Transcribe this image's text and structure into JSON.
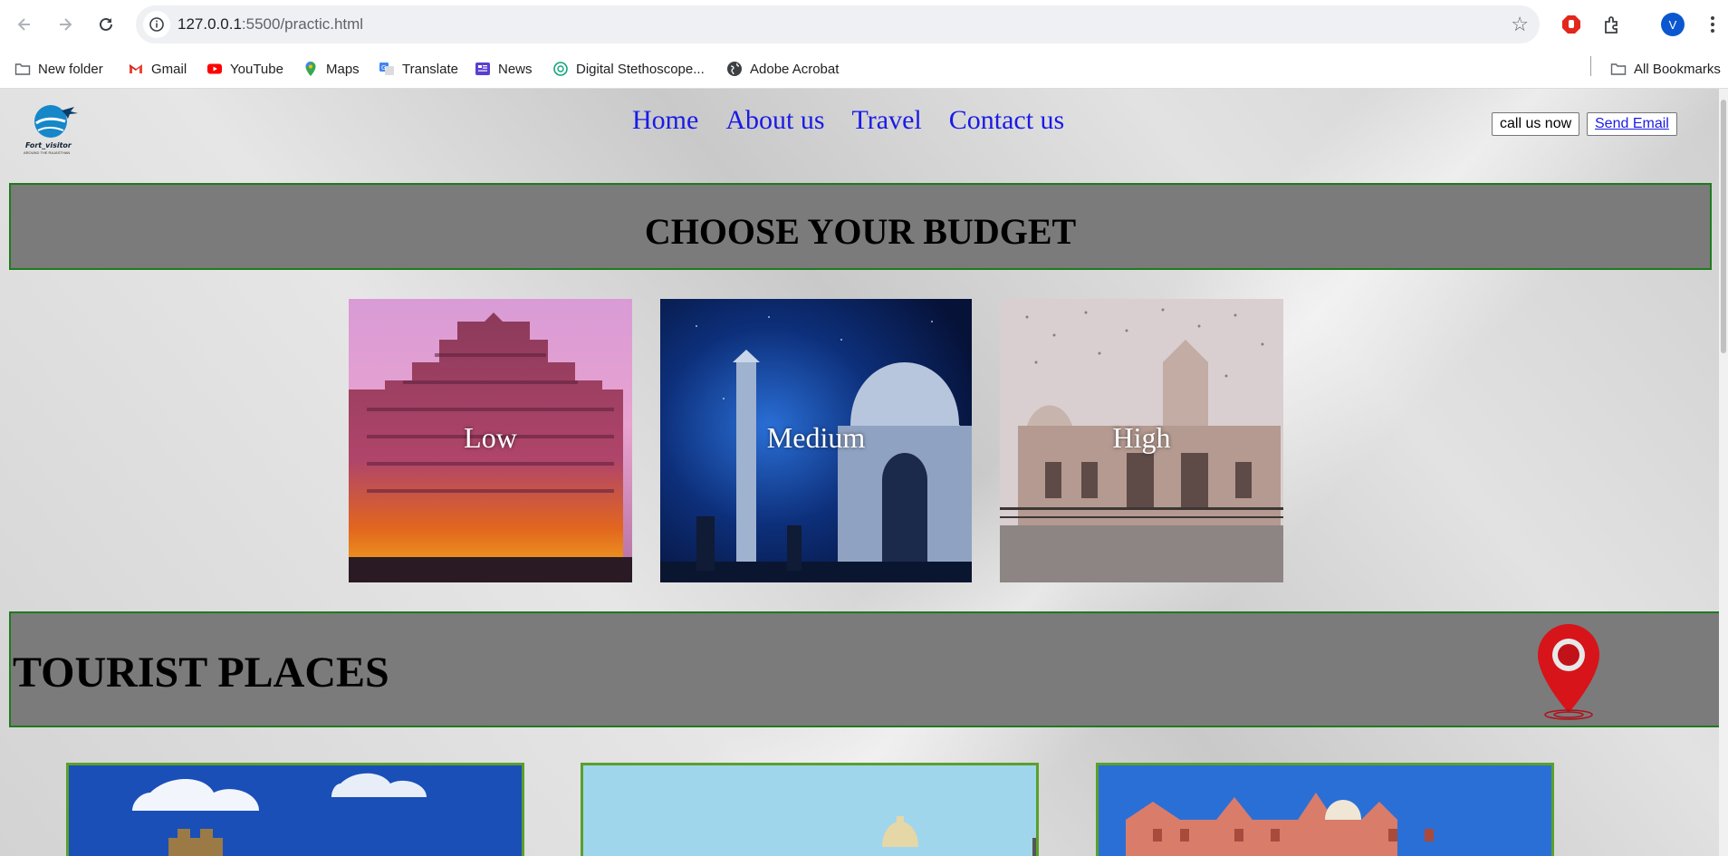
{
  "browser": {
    "url_host": "127.0.0.1",
    "url_path": ":5500/practic.html",
    "profile_initial": "V"
  },
  "bookmarks": {
    "items": [
      "New folder",
      "Gmail",
      "YouTube",
      "Maps",
      "Translate",
      "News",
      "Digital Stethoscope...",
      "Adobe Acrobat"
    ],
    "all_bookmarks": "All Bookmarks"
  },
  "header": {
    "logo_text": "Fort_visitor",
    "logo_sub": "AROUND THE RAJASTHAN",
    "nav": [
      "Home",
      "About us",
      "Travel",
      "Contact us"
    ],
    "call_button": "call us now",
    "email_link": "Send Email"
  },
  "budget": {
    "heading": "CHOOSE YOUR BUDGET",
    "options": [
      "Low",
      "Medium",
      "High"
    ]
  },
  "tourist": {
    "heading": "TOURIST PLACES"
  },
  "colors": {
    "nav_link": "#1a1ae6",
    "band_bg": "#7b7b7b",
    "band_border": "#1f7a1f",
    "pin": "#d7141a"
  }
}
